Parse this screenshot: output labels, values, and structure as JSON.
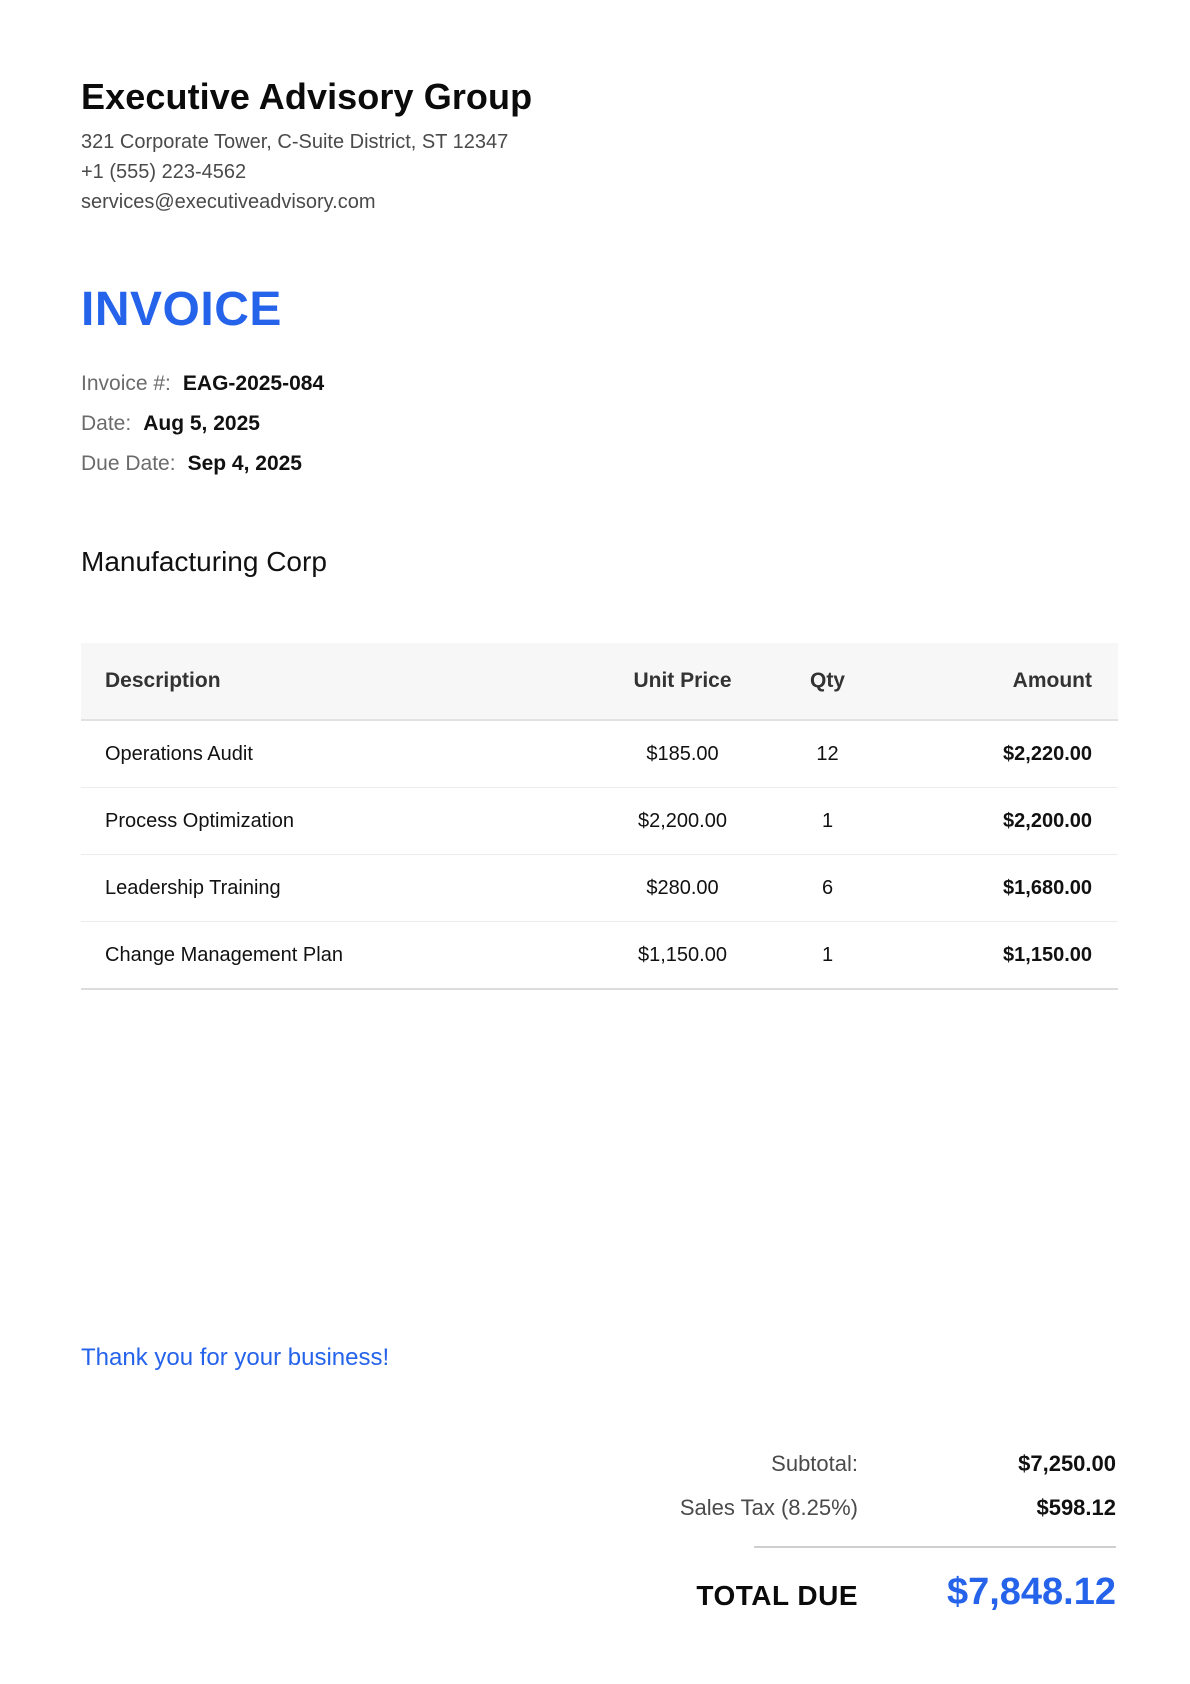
{
  "company": {
    "name": "Executive Advisory Group",
    "address": "321 Corporate Tower, C-Suite District, ST 12347",
    "phone": "+1 (555) 223-4562",
    "email": "services@executiveadvisory.com"
  },
  "title": "INVOICE",
  "meta": {
    "invoice_label": "Invoice #:",
    "invoice_value": "EAG-2025-084",
    "date_label": "Date:",
    "date_value": "Aug 5, 2025",
    "due_label": "Due Date:",
    "due_value": "Sep 4, 2025"
  },
  "client": "Manufacturing Corp",
  "table": {
    "headers": {
      "description": "Description",
      "unit_price": "Unit Price",
      "qty": "Qty",
      "amount": "Amount"
    },
    "rows": [
      {
        "description": "Operations Audit",
        "unit_price": "$185.00",
        "qty": "12",
        "amount": "$2,220.00"
      },
      {
        "description": "Process Optimization",
        "unit_price": "$2,200.00",
        "qty": "1",
        "amount": "$2,200.00"
      },
      {
        "description": "Leadership Training",
        "unit_price": "$280.00",
        "qty": "6",
        "amount": "$1,680.00"
      },
      {
        "description": "Change Management Plan",
        "unit_price": "$1,150.00",
        "qty": "1",
        "amount": "$1,150.00"
      }
    ]
  },
  "thanks": "Thank you for your business!",
  "totals": {
    "subtotal_label": "Subtotal:",
    "subtotal_value": "$7,250.00",
    "tax_label": "Sales Tax (8.25%)",
    "tax_value": "$598.12",
    "total_label": "TOTAL DUE",
    "total_value": "$7,848.12"
  },
  "colors": {
    "accent": "#2563eb"
  }
}
